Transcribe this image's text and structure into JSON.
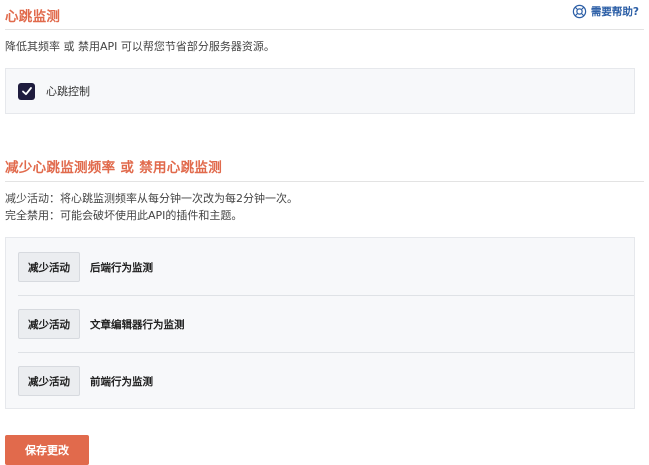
{
  "heartbeat": {
    "title": "心跳监测",
    "help_label": "需要帮助?",
    "description": "降低其频率 或 禁用API 可以帮您节省部分服务器资源。",
    "control_label": "心跳控制",
    "control_checked": true
  },
  "reduce": {
    "title": "减少心跳监测频率 或 禁用心跳监测",
    "desc_line1": "减少活动：将心跳监测频率从每分钟一次改为每2分钟一次。",
    "desc_line2": "完全禁用：可能会破坏使用此API的插件和主题。",
    "rows": [
      {
        "button": "减少活动",
        "label": "后端行为监测"
      },
      {
        "button": "减少活动",
        "label": "文章编辑器行为监测"
      },
      {
        "button": "减少活动",
        "label": "前端行为监测"
      }
    ]
  },
  "save_label": "保存更改",
  "colors": {
    "accent": "#e16a4c",
    "link": "#2b5ea6",
    "checkbox": "#1f1c3e"
  },
  "icons": {
    "help": "lifebuoy-icon",
    "check": "checkmark-icon"
  }
}
